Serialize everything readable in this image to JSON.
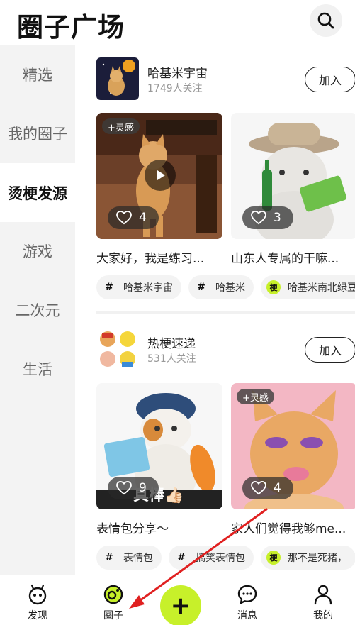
{
  "header": {
    "title": "圈子广场"
  },
  "sidebar": {
    "items": [
      {
        "label": "精选"
      },
      {
        "label": "我的圈子"
      },
      {
        "label": "烫梗发源"
      },
      {
        "label": "游戏"
      },
      {
        "label": "二次元"
      },
      {
        "label": "生活"
      }
    ],
    "active_index": 2
  },
  "circles": [
    {
      "name": "哈基米宇宙",
      "followers": "1749人关注",
      "join_label": "加入",
      "posts": [
        {
          "badge": "+灵感",
          "likes": "4",
          "title": "大家好，我是练习...",
          "has_video": true
        },
        {
          "badge": "",
          "likes": "3",
          "title": "山东人专属的干嘛...",
          "has_video": false
        }
      ],
      "tags": [
        {
          "icon": "#",
          "label": "哈基米宇宙"
        },
        {
          "icon": "#",
          "label": "哈基米"
        },
        {
          "icon": "梗",
          "label": "哈基米南北绿豆"
        }
      ]
    },
    {
      "name": "热梗速递",
      "followers": "531人关注",
      "join_label": "加入",
      "posts": [
        {
          "badge": "",
          "likes": "9",
          "title": "表情包分享～",
          "overlay_text": "真棒👍🏻",
          "has_video": false
        },
        {
          "badge": "+灵感",
          "likes": "4",
          "title": "家人们觉得我够me...",
          "has_video": false
        }
      ],
      "tags": [
        {
          "icon": "#",
          "label": "表情包"
        },
        {
          "icon": "#",
          "label": "搞笑表情包"
        },
        {
          "icon": "梗",
          "label": "那不是死猪，"
        }
      ]
    }
  ],
  "bottom_nav": {
    "discover": "发现",
    "circle": "圈子",
    "messages": "消息",
    "mine": "我的",
    "plus_symbol": "+"
  },
  "colors": {
    "accent": "#c7f02a",
    "arrow": "#e02020"
  }
}
